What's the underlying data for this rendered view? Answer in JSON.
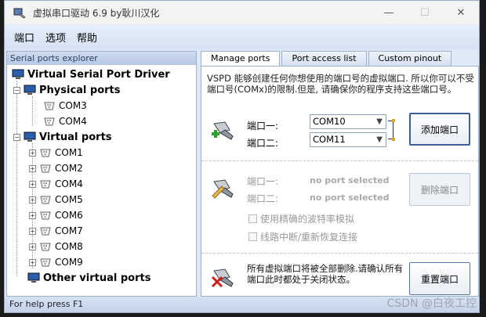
{
  "window": {
    "title": "虚拟串口驱动 6.9 by耿川汉化",
    "controls": {
      "minimize": "—",
      "maximize": "☐",
      "close": "✕"
    }
  },
  "menu": [
    "端口",
    "选项",
    "帮助"
  ],
  "left_panel": {
    "header": "Serial ports explorer",
    "root": "Virtual Serial Port Driver",
    "physical_label": "Physical ports",
    "physical_ports": [
      "COM3",
      "COM4"
    ],
    "virtual_label": "Virtual ports",
    "virtual_ports": [
      "COM1",
      "COM2",
      "COM4",
      "COM5",
      "COM6",
      "COM7",
      "COM8",
      "COM9"
    ],
    "other_label": "Other virtual ports"
  },
  "status_bar": "For help press F1",
  "tabs": [
    "Manage ports",
    "Port access list",
    "Custom pinout"
  ],
  "active_tab": 0,
  "description": "VSPD 能够创建任何你想使用的端口号的虚拟端口. 所以你可以不受端口号(COMx)的限制.但是, 请确保你的程序支持这些端口号。",
  "add_section": {
    "port1_label": "端口一:",
    "port2_label": "端口二:",
    "port1_value": "COM10",
    "port2_value": "COM11",
    "button": "添加端口"
  },
  "delete_section": {
    "port1_label": "端口一:",
    "port2_label": "端口二:",
    "port1_value": "no port selected",
    "port2_value": "no port selected",
    "button": "删除端口",
    "option1": "使用精确的波特率模拟",
    "option2": "线路中断/重新恢复连接"
  },
  "reset_section": {
    "text": "所有虚拟端口将被全部删除.请确认所有端口此时都处于关闭状态。",
    "button": "重置端口"
  },
  "watermark": "CSDN @白夜工控"
}
